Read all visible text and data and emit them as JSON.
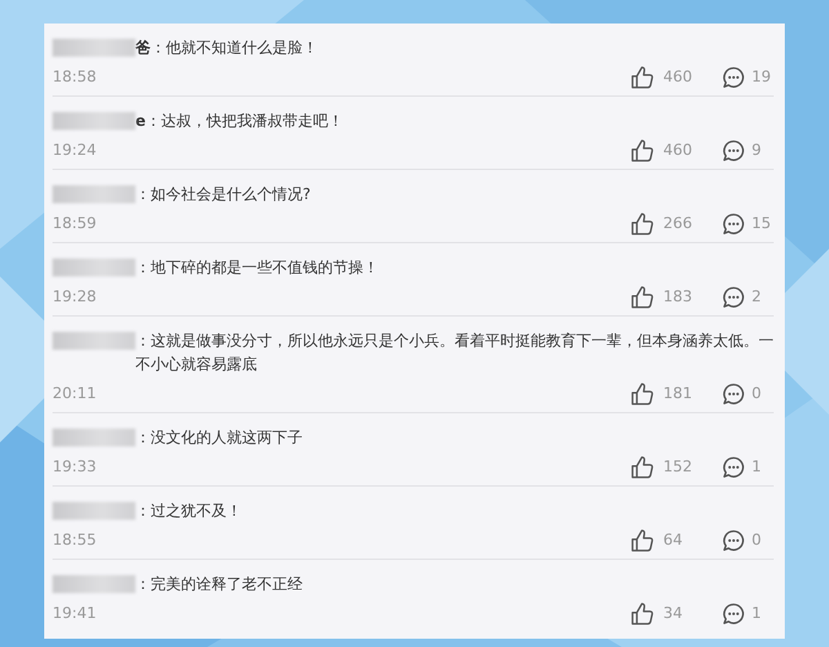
{
  "comments": [
    {
      "name_tail": "爸",
      "text": "：他就不知道什么是脸！",
      "time": "18:58",
      "likes": "460",
      "replies": "19"
    },
    {
      "name_tail": "e",
      "text": "：达叔，快把我潘叔带走吧！",
      "time": "19:24",
      "likes": "460",
      "replies": "9"
    },
    {
      "text": "：如今社会是什么个情况?",
      "time": "18:59",
      "likes": "266",
      "replies": "15"
    },
    {
      "text": "：地下碎的都是一些不值钱的节操！",
      "time": "19:28",
      "likes": "183",
      "replies": "2"
    },
    {
      "text": "：这就是做事没分寸，所以他永远只是个小兵。看着平时挺能教育下一辈，但本身涵养太低。一不小心就容易露底",
      "time": "20:11",
      "likes": "181",
      "replies": "0"
    },
    {
      "text": "：没文化的人就这两下子",
      "time": "19:33",
      "likes": "152",
      "replies": "1"
    },
    {
      "text": "：过之犹不及！",
      "time": "18:55",
      "likes": "64",
      "replies": "0"
    },
    {
      "text": "：完美的诠释了老不正经",
      "time": "19:41",
      "likes": "34",
      "replies": "1"
    }
  ]
}
